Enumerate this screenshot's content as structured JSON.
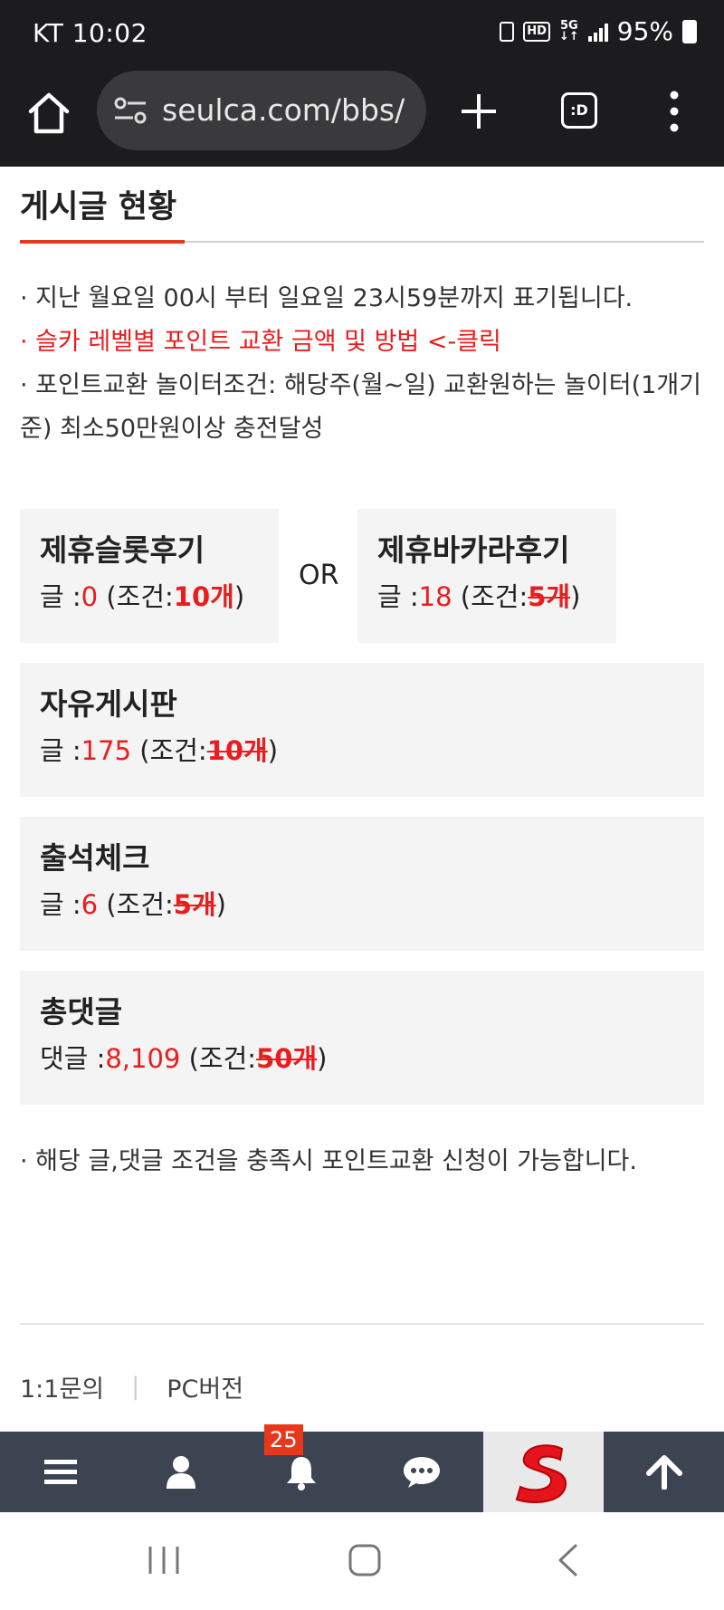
{
  "status_bar": {
    "carrier_time": "KT 10:02",
    "battery": "95%"
  },
  "browser": {
    "url": "seulca.com/bbs/",
    "tabs_icon_text": ":D"
  },
  "page": {
    "section_title": "게시글 현황",
    "notes": [
      "· 지난 월요일 00시 부터 일요일 23시59분까지 표기됩니다.",
      "· 슬카 레벨별 포인트 교환 금액 및 방법 <-클릭",
      "· 포인트교환 놀이터조건: 해당주(월~일) 교환원하는 놀이터(1개기준) 최소50만원이상 충전달성"
    ],
    "or_label": "OR",
    "boards": {
      "slot": {
        "title": "제휴슬롯후기",
        "prefix": "글 :",
        "count": "0",
        "cond_open": "(조건:",
        "cond_value": "10개",
        "cond_close": ")"
      },
      "baccarat": {
        "title": "제휴바카라후기",
        "prefix": "글 :",
        "count": "18",
        "cond_open": "(조건:",
        "cond_value": "5개",
        "cond_close": ")"
      },
      "free": {
        "title": "자유게시판",
        "prefix": "글 :",
        "count": "175",
        "cond_open": "(조건:",
        "cond_value": "10개",
        "cond_close": ")"
      },
      "attendance": {
        "title": "출석체크",
        "prefix": "글 :",
        "count": "6",
        "cond_open": "(조건:",
        "cond_value": "5개",
        "cond_close": ")"
      },
      "comments": {
        "title": "총댓글",
        "prefix": "댓글 :",
        "count": "8,109",
        "cond_open": "(조건:",
        "cond_value": "50개",
        "cond_close": ")"
      }
    },
    "bottom_note": "· 해당 글,댓글 조건을 충족시 포인트교환 신청이 가능합니다.",
    "footer": {
      "inquiry": "1:1문의",
      "separator": "|",
      "pc_version": "PC버전"
    }
  },
  "bottom_nav": {
    "notification_count": "25",
    "items": [
      "menu-icon",
      "user-icon",
      "bell-icon",
      "chat-icon",
      "site-logo",
      "arrow-up-icon"
    ]
  },
  "colors": {
    "accent": "#e8381b",
    "highlight": "#e81d1d",
    "nav_bg": "#3b4450",
    "browser_bg": "#1c1c1e"
  }
}
